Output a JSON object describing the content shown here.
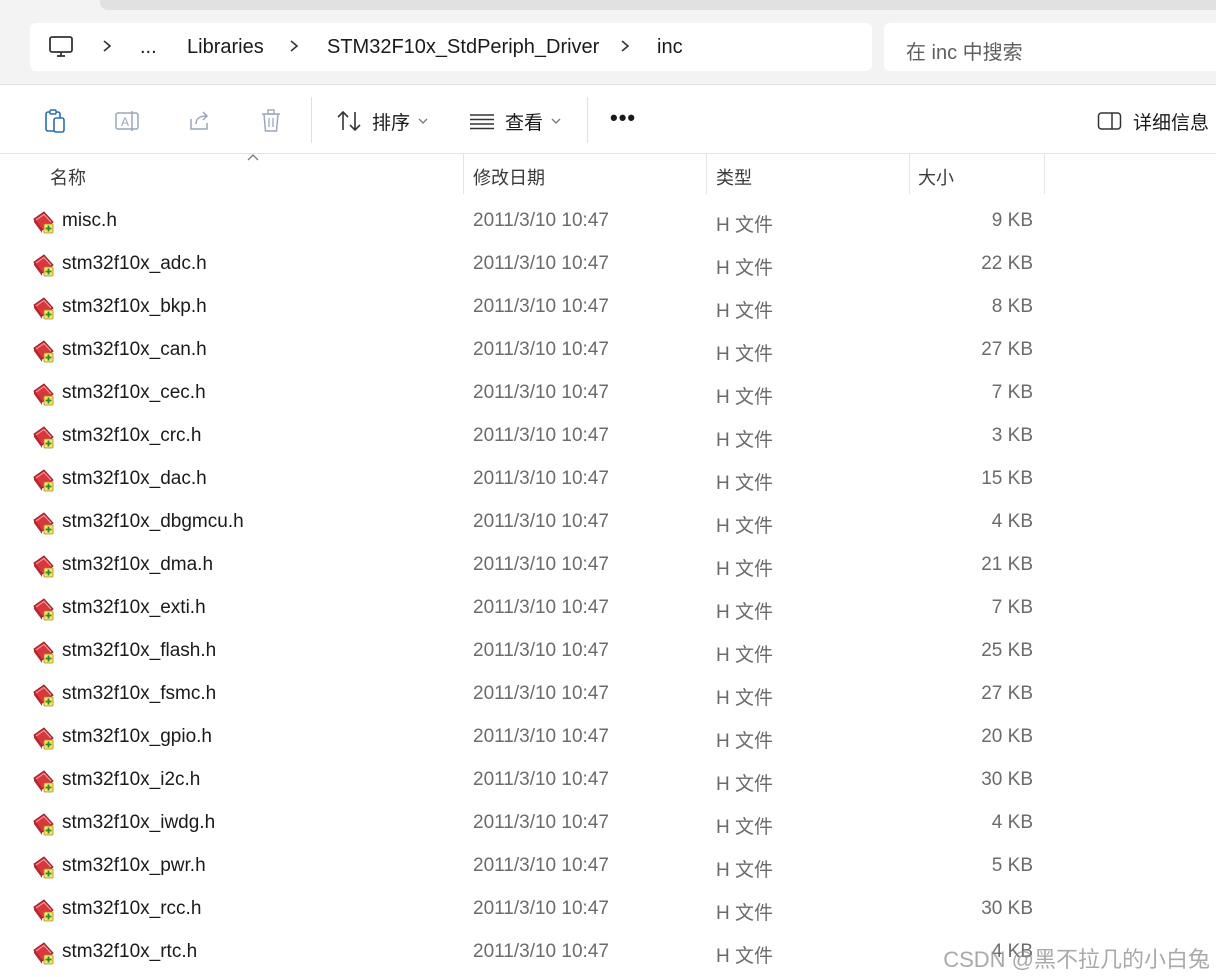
{
  "breadcrumb": {
    "items": [
      "...",
      "Libraries",
      "STM32F10x_StdPeriph_Driver",
      "inc"
    ]
  },
  "search": {
    "placeholder": "在 inc 中搜索"
  },
  "toolbar": {
    "sort_label": "排序",
    "view_label": "查看",
    "more_label": "•••",
    "details_label": "详细信息"
  },
  "columns": {
    "name": "名称",
    "date": "修改日期",
    "type": "类型",
    "size": "大小"
  },
  "files": [
    {
      "name": "misc.h",
      "date": "2011/3/10 10:47",
      "type": "H 文件",
      "size": "9 KB"
    },
    {
      "name": "stm32f10x_adc.h",
      "date": "2011/3/10 10:47",
      "type": "H 文件",
      "size": "22 KB"
    },
    {
      "name": "stm32f10x_bkp.h",
      "date": "2011/3/10 10:47",
      "type": "H 文件",
      "size": "8 KB"
    },
    {
      "name": "stm32f10x_can.h",
      "date": "2011/3/10 10:47",
      "type": "H 文件",
      "size": "27 KB"
    },
    {
      "name": "stm32f10x_cec.h",
      "date": "2011/3/10 10:47",
      "type": "H 文件",
      "size": "7 KB"
    },
    {
      "name": "stm32f10x_crc.h",
      "date": "2011/3/10 10:47",
      "type": "H 文件",
      "size": "3 KB"
    },
    {
      "name": "stm32f10x_dac.h",
      "date": "2011/3/10 10:47",
      "type": "H 文件",
      "size": "15 KB"
    },
    {
      "name": "stm32f10x_dbgmcu.h",
      "date": "2011/3/10 10:47",
      "type": "H 文件",
      "size": "4 KB"
    },
    {
      "name": "stm32f10x_dma.h",
      "date": "2011/3/10 10:47",
      "type": "H 文件",
      "size": "21 KB"
    },
    {
      "name": "stm32f10x_exti.h",
      "date": "2011/3/10 10:47",
      "type": "H 文件",
      "size": "7 KB"
    },
    {
      "name": "stm32f10x_flash.h",
      "date": "2011/3/10 10:47",
      "type": "H 文件",
      "size": "25 KB"
    },
    {
      "name": "stm32f10x_fsmc.h",
      "date": "2011/3/10 10:47",
      "type": "H 文件",
      "size": "27 KB"
    },
    {
      "name": "stm32f10x_gpio.h",
      "date": "2011/3/10 10:47",
      "type": "H 文件",
      "size": "20 KB"
    },
    {
      "name": "stm32f10x_i2c.h",
      "date": "2011/3/10 10:47",
      "type": "H 文件",
      "size": "30 KB"
    },
    {
      "name": "stm32f10x_iwdg.h",
      "date": "2011/3/10 10:47",
      "type": "H 文件",
      "size": "4 KB"
    },
    {
      "name": "stm32f10x_pwr.h",
      "date": "2011/3/10 10:47",
      "type": "H 文件",
      "size": "5 KB"
    },
    {
      "name": "stm32f10x_rcc.h",
      "date": "2011/3/10 10:47",
      "type": "H 文件",
      "size": "30 KB"
    },
    {
      "name": "stm32f10x_rtc.h",
      "date": "2011/3/10 10:47",
      "type": "H 文件",
      "size": "4 KB"
    }
  ],
  "icons": {
    "computer": "computer-icon",
    "breadcrumb_separator": "chevron-right-icon",
    "copy": "clipboard-icon",
    "rename": "rename-icon",
    "share": "share-icon",
    "delete": "trash-icon",
    "sort": "sort-icon",
    "view": "view-list-icon",
    "details": "details-pane-icon",
    "file": "h-file-icon"
  },
  "colors": {
    "accent_file_icon": "#d9363e",
    "toolbar_disabled": "#9aa7b8",
    "secondary_text": "#6b6b6b"
  },
  "watermark": "CSDN @黑不拉几的小白兔"
}
